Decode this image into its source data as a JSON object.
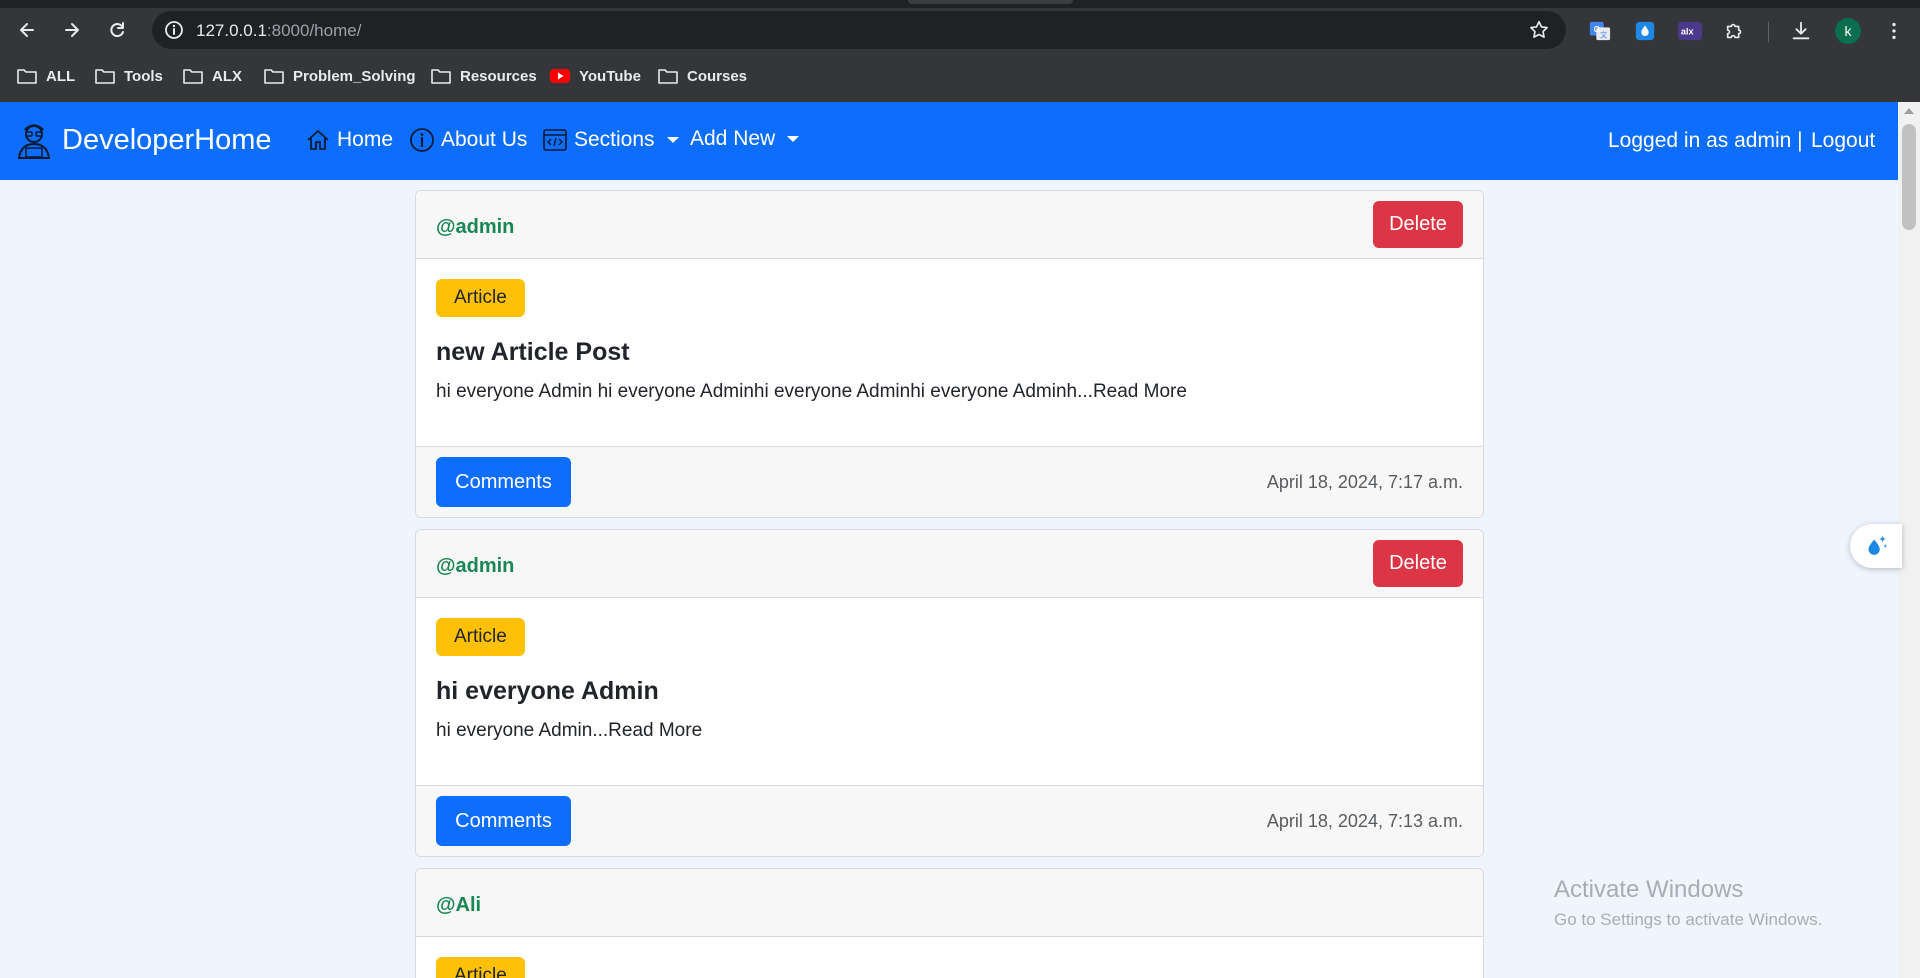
{
  "browser": {
    "url_host": "127.0.0.1",
    "url_rest": ":8000/home/",
    "profile_initial": "k",
    "ext_alx_label": "alx",
    "bookmarks": [
      {
        "label": "ALL",
        "icon": "folder-icon"
      },
      {
        "label": "Tools",
        "icon": "folder-icon"
      },
      {
        "label": "ALX",
        "icon": "folder-icon"
      },
      {
        "label": "Problem_Solving",
        "icon": "folder-icon"
      },
      {
        "label": "Resources",
        "icon": "folder-icon"
      },
      {
        "label": "YouTube",
        "icon": "youtube-icon"
      },
      {
        "label": "Courses",
        "icon": "folder-icon"
      }
    ]
  },
  "navbar": {
    "brand": "DeveloperHome",
    "home": "Home",
    "about": "About Us",
    "sections": "Sections",
    "add_new": "Add New",
    "logged_in": "Logged in as admin |",
    "logout": "Logout"
  },
  "posts": [
    {
      "author": "@admin",
      "delete_label": "Delete",
      "badge": "Article",
      "title": "new Article Post",
      "excerpt": "hi everyone Admin hi everyone Adminhi everyone Adminhi everyone Adminh...Read More",
      "comments_label": "Comments",
      "timestamp": "April 18, 2024, 7:17 a.m."
    },
    {
      "author": "@admin",
      "delete_label": "Delete",
      "badge": "Article",
      "title": "hi everyone Admin",
      "excerpt": "hi everyone Admin...Read More",
      "comments_label": "Comments",
      "timestamp": "April 18, 2024, 7:13 a.m."
    },
    {
      "author": "@Ali",
      "badge": "Article"
    }
  ],
  "watermark": {
    "title": "Activate Windows",
    "subtitle": "Go to Settings to activate Windows."
  },
  "colors": {
    "navbar": "#0d6efd",
    "delete": "#dc3545",
    "badge": "#ffc107",
    "author": "#198754"
  }
}
